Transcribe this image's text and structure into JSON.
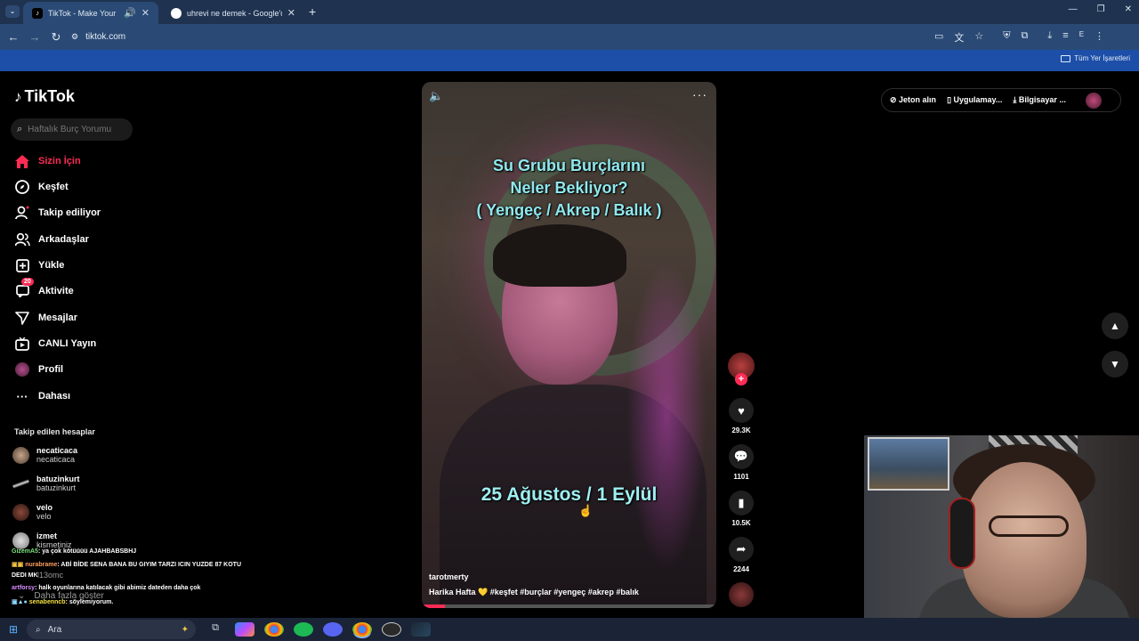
{
  "browser": {
    "tabs": [
      {
        "title": "TikTok - Make Your Day",
        "active": true
      },
      {
        "title": "uhrevi ne demek - Google'da A",
        "active": false
      }
    ],
    "url": "tiktok.com",
    "bookmarks_folder": "Tüm Yer İşaretleri",
    "window_controls": [
      "—",
      "❐",
      "✕"
    ]
  },
  "tiktok": {
    "logo": "TikTok",
    "search_placeholder": "Haftalık Burç Yorumu",
    "nav": [
      {
        "label": "Sizin İçin",
        "icon": "home-icon",
        "selected": true
      },
      {
        "label": "Keşfet",
        "icon": "compass-icon"
      },
      {
        "label": "Takip ediliyor",
        "icon": "following-icon"
      },
      {
        "label": "Arkadaşlar",
        "icon": "friends-icon"
      },
      {
        "label": "Yükle",
        "icon": "upload-icon"
      },
      {
        "label": "Aktivite",
        "icon": "activity-icon",
        "badge": "20"
      },
      {
        "label": "Mesajlar",
        "icon": "messages-icon"
      },
      {
        "label": "CANLI Yayın",
        "icon": "live-icon"
      },
      {
        "label": "Profil",
        "icon": "profile-icon"
      },
      {
        "label": "Dahası",
        "icon": "more-icon"
      }
    ],
    "following_title": "Takip edilen hesaplar",
    "following": [
      {
        "name": "necaticaca",
        "handle": "necaticaca"
      },
      {
        "name": "batuzinkurt",
        "handle": "batuzinkurt"
      },
      {
        "name": "velo",
        "handle": "velo"
      },
      {
        "name": "izmet",
        "handle": "kismetiniz"
      }
    ],
    "partial_handle": "l13omc",
    "show_more": "Daha fazla göster",
    "top_right": {
      "coins": "Jeton alın",
      "app": "Uygulamay...",
      "computer": "Bilgisayar ..."
    },
    "video": {
      "title_lines": [
        "Su Grubu Burçlarını",
        "Neler Bekliyor?",
        "( Yengeç / Akrep / Balık )"
      ],
      "date_text": "25 Ağustos / 1 Eylül",
      "author": "tarotmerty",
      "description": "Harika Hafta 💛 #keşfet #burçlar #yengeç #akrep #balık",
      "progress_fraction": 0.08
    },
    "actions": {
      "likes": "29.3K",
      "comments": "1101",
      "saves": "10.5K",
      "shares": "2244"
    }
  },
  "chat": [
    {
      "user": "GizemA5",
      "text": ": ya çok kötüüüü AJAHBABSBHJ"
    },
    {
      "user": "nurabrame",
      "text": ": ABİ BİDE SENA BANA BU GIYIM TARZI ICIN YUZDE 87 KOTU"
    },
    {
      "user": "",
      "text": "DEDI MK"
    },
    {
      "user": "artforsy",
      "text": ": halk oyunlarına katılacak gibi abimiz dateden daha çok"
    },
    {
      "user": "senabenncb",
      "text": ": söylemiyorum."
    }
  ],
  "taskbar": {
    "search_placeholder": "Ara"
  },
  "colors": {
    "tiktok_red": "#fe2c55",
    "chrome_frame": "#1f3350",
    "bookmarks_bar": "#1d4fa8"
  }
}
